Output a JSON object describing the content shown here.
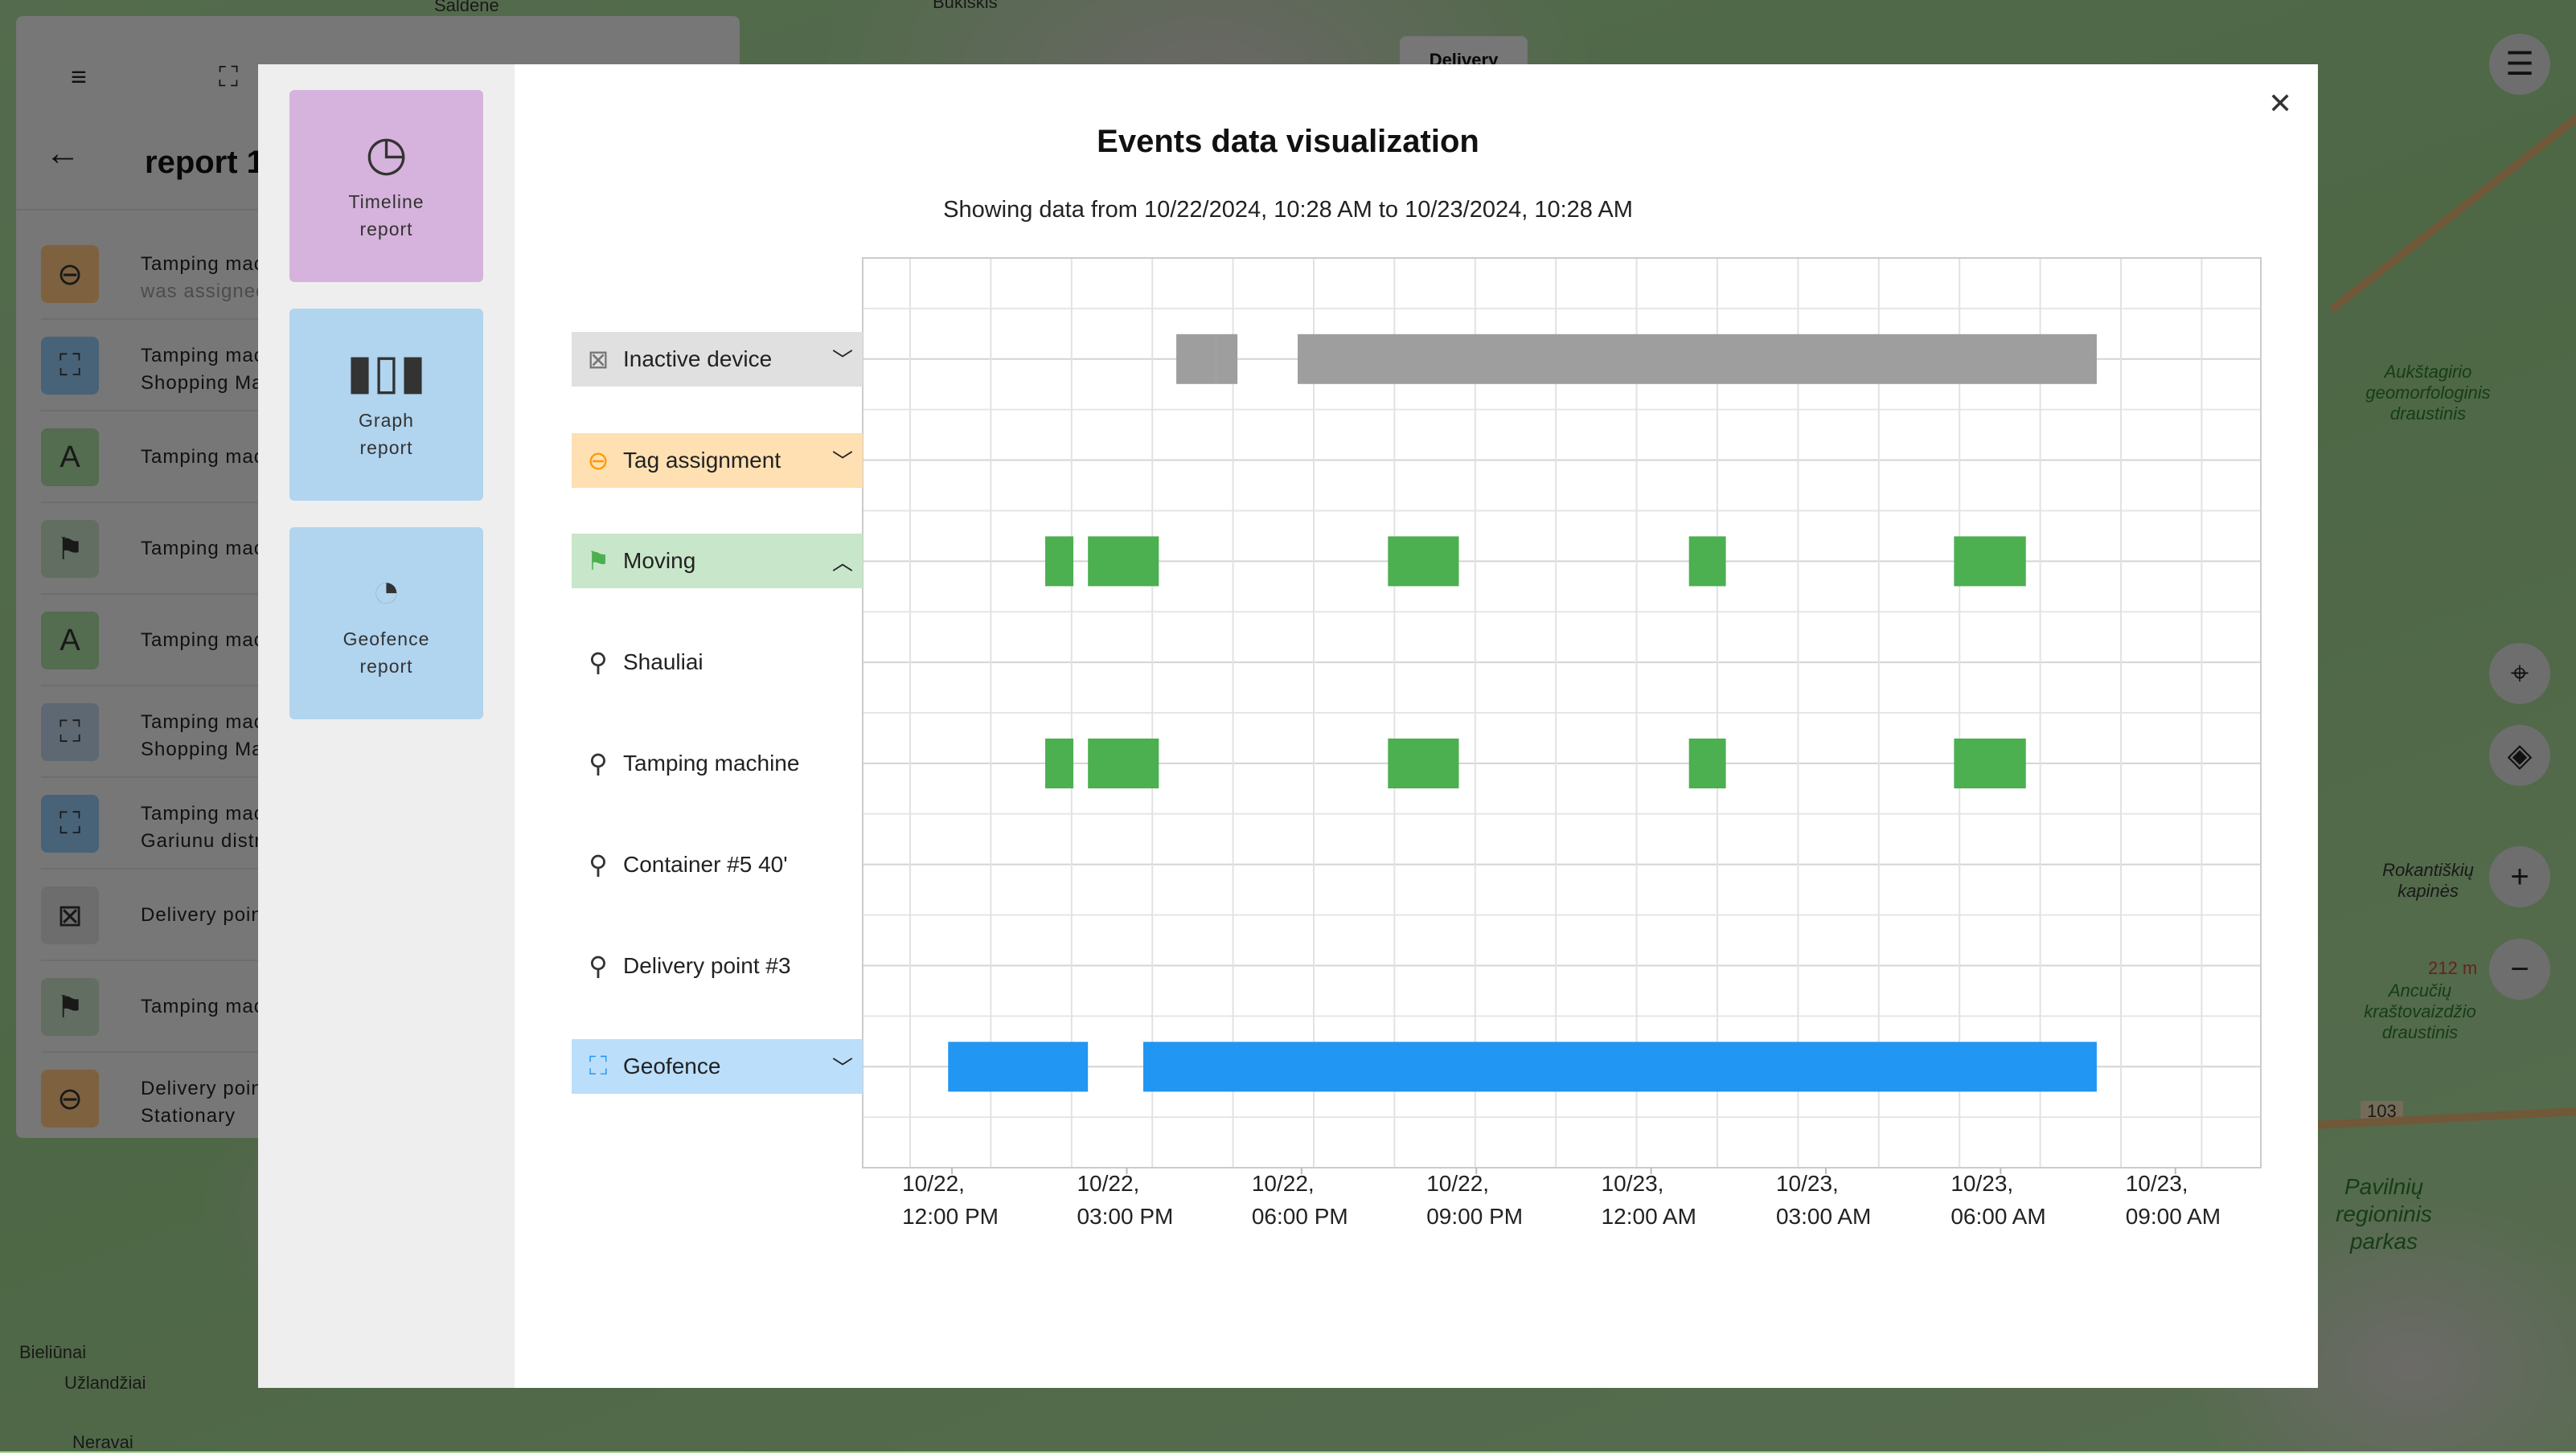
{
  "map": {
    "labels": [
      "Saldene",
      "Bukiškis",
      "Aukštagirio geomorfologinis draustinis",
      "Rokantiškių kapinės",
      "Ancučių kraštovaizdžio draustinis",
      "Pavilnių regioninis parkas",
      "Bieliūnai",
      "Užlandžiai",
      "Neravai",
      "212 m",
      "103"
    ],
    "chip": "Delivery"
  },
  "left_panel": {
    "title": "report 1",
    "items": [
      {
        "icon": "tag-link-icon",
        "color": "#fdc37e",
        "line1": "Tamping mach",
        "line2": "was assigned"
      },
      {
        "icon": "geofence-enter-icon",
        "color": "#90c4f0",
        "line1": "Tamping mach",
        "line2": "Shopping Mall"
      },
      {
        "icon": "letter-a-icon",
        "color": "#a8d8a0",
        "line1": "Tamping mach",
        "line2": ""
      },
      {
        "icon": "moving-flag-icon",
        "color": "#c4dcc4",
        "line1": "Tamping mach",
        "line2": ""
      },
      {
        "icon": "letter-a-icon",
        "color": "#a8d8a0",
        "line1": "Tamping mach",
        "line2": ""
      },
      {
        "icon": "geofence-exit-icon",
        "color": "#bcd0e4",
        "line1": "Tamping mach",
        "line2": "Shopping Mall"
      },
      {
        "icon": "geofence-enter-icon",
        "color": "#90c4f0",
        "line1": "Tamping mach",
        "line2": "Gariunu distric"
      },
      {
        "icon": "inactive-device-icon",
        "color": "#dadada",
        "line1": "Delivery point",
        "line2": ""
      },
      {
        "icon": "moving-flag-icon",
        "color": "#c4dcc4",
        "line1": "Tamping mach",
        "line2": ""
      },
      {
        "icon": "tag-link-icon",
        "color": "#fdc37e",
        "line1": "Delivery point",
        "line2": "Stationary"
      }
    ]
  },
  "modal": {
    "report_types": [
      {
        "label1": "Timeline",
        "label2": "report",
        "icon": "timeline-icon",
        "color": "#d6b3dc",
        "selected": true
      },
      {
        "label1": "Graph",
        "label2": "report",
        "icon": "bar-chart-icon",
        "color": "#b1d4ef",
        "selected": false
      },
      {
        "label1": "Geofence",
        "label2": "report",
        "icon": "pie-chart-icon",
        "color": "#b1d4ef",
        "selected": false
      }
    ],
    "title": "Events data visualization",
    "range_text": "Showing data from 10/22/2024, 10:28 AM to 10/23/2024, 10:28 AM"
  },
  "chart_data": {
    "type": "timeline",
    "x_range": [
      "2024-10-22T10:28",
      "2024-10-23T10:28"
    ],
    "grid": true,
    "ticks": [
      {
        "t": "2024-10-22T12:00",
        "l1": "10/22,",
        "l2": "12:00 PM"
      },
      {
        "t": "2024-10-22T15:00",
        "l1": "10/22,",
        "l2": "03:00 PM"
      },
      {
        "t": "2024-10-22T18:00",
        "l1": "10/22,",
        "l2": "06:00 PM"
      },
      {
        "t": "2024-10-22T21:00",
        "l1": "10/22,",
        "l2": "09:00 PM"
      },
      {
        "t": "2024-10-23T00:00",
        "l1": "10/23,",
        "l2": "12:00 AM"
      },
      {
        "t": "2024-10-23T03:00",
        "l1": "10/23,",
        "l2": "03:00 AM"
      },
      {
        "t": "2024-10-23T06:00",
        "l1": "10/23,",
        "l2": "06:00 AM"
      },
      {
        "t": "2024-10-23T09:00",
        "l1": "10/23,",
        "l2": "09:00 AM"
      }
    ],
    "rows": [
      {
        "label": "Inactive device",
        "icon": "inactive-device-icon",
        "bg": "#e0e0e0",
        "icon_color": "#777",
        "chevron": "down",
        "bar_color": "#9e9e9e",
        "segments": [
          [
            "2024-10-22T15:51",
            "2024-10-22T16:32"
          ],
          [
            "2024-10-22T16:32",
            "2024-10-22T16:54"
          ],
          [
            "2024-10-22T17:56",
            "2024-10-23T07:39"
          ]
        ]
      },
      {
        "label": "Tag assignment",
        "icon": "tag-link-icon",
        "bg": "#ffe0b2",
        "icon_color": "#ff9800",
        "chevron": "down",
        "bar_color": "#ff9800",
        "segments": []
      },
      {
        "label": "Moving",
        "icon": "moving-flag-icon",
        "bg": "#c8e6c9",
        "icon_color": "#4caf50",
        "chevron": "up",
        "bar_color": "#4caf50",
        "segments": [
          [
            "2024-10-22T13:36",
            "2024-10-22T14:05"
          ],
          [
            "2024-10-22T14:20",
            "2024-10-22T15:33"
          ],
          [
            "2024-10-22T19:29",
            "2024-10-22T20:42"
          ],
          [
            "2024-10-23T00:39",
            "2024-10-23T01:17"
          ],
          [
            "2024-10-23T05:12",
            "2024-10-23T06:26"
          ]
        ]
      },
      {
        "label": "Shauliai",
        "icon": "location-pin-icon",
        "bg": "",
        "icon_color": "#333",
        "chevron": "",
        "bar_color": "#4caf50",
        "segments": []
      },
      {
        "label": "Tamping machine",
        "icon": "location-pin-icon",
        "bg": "",
        "icon_color": "#333",
        "chevron": "",
        "bar_color": "#4caf50",
        "segments": [
          [
            "2024-10-22T13:36",
            "2024-10-22T14:05"
          ],
          [
            "2024-10-22T14:20",
            "2024-10-22T15:33"
          ],
          [
            "2024-10-22T19:29",
            "2024-10-22T20:42"
          ],
          [
            "2024-10-23T00:39",
            "2024-10-23T01:17"
          ],
          [
            "2024-10-23T05:12",
            "2024-10-23T06:26"
          ]
        ]
      },
      {
        "label": "Container #5 40'",
        "icon": "location-pin-icon",
        "bg": "",
        "icon_color": "#333",
        "chevron": "",
        "bar_color": "#4caf50",
        "segments": []
      },
      {
        "label": "Delivery point #3",
        "icon": "location-pin-icon",
        "bg": "",
        "icon_color": "#333",
        "chevron": "",
        "bar_color": "#4caf50",
        "segments": []
      },
      {
        "label": "Geofence",
        "icon": "geofence-icon",
        "bg": "#bbdefb",
        "icon_color": "#2196f3",
        "chevron": "down",
        "bar_color": "#2196f3",
        "segments": [
          [
            "2024-10-22T11:56",
            "2024-10-22T14:20"
          ],
          [
            "2024-10-22T15:17",
            "2024-10-23T07:39"
          ]
        ]
      }
    ]
  }
}
